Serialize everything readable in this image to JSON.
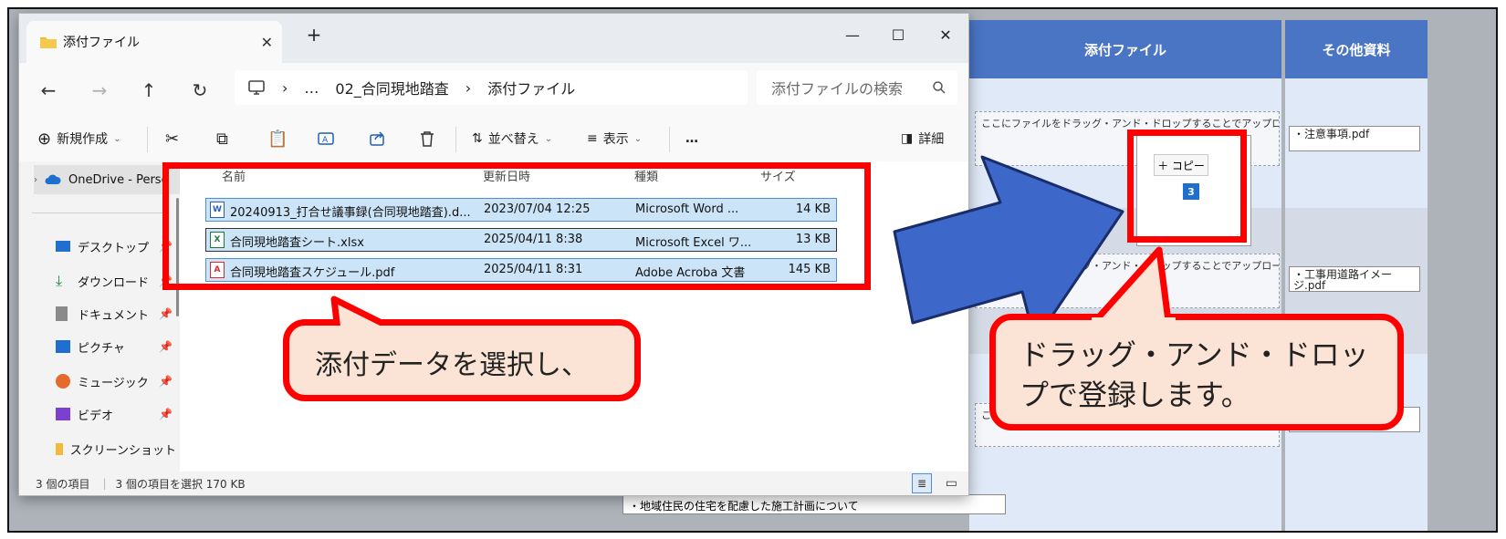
{
  "webapp": {
    "col_attach_header": "添付ファイル",
    "col_other_header": "その他資料",
    "dropzone1_text": "ここにファイルをドラッグ・アンド・ドロップすることでアップロードできます。",
    "dropzone2_text": "ラッグ・アンド・ドロップすることでアップロードできます。",
    "dropzone3_text": "こ",
    "other_file1": "・注意事項.pdf",
    "other_file2": "・工事用道路イメージ.pdf",
    "bottom_note": "・地域住民の住宅を配慮した施工計画について",
    "copy_label": "＋ コピー",
    "copy_count": "3"
  },
  "explorer": {
    "tab_title": "添付ファイル",
    "new_tab": "+",
    "breadcrumb": [
      "02_合同現地踏査",
      "添付ファイル"
    ],
    "breadcrumb_more": "…",
    "search_placeholder": "添付ファイルの検索",
    "toolbar": {
      "new_label": "新規作成",
      "sort_label": "並べ替え",
      "view_label": "表示",
      "more_label": "…",
      "details_label": "詳細"
    },
    "sidebar": {
      "onedrive": "OneDrive - Perso",
      "items": [
        {
          "label": "デスクトップ",
          "icon": "desktop-icon",
          "color": "#1e6fd0"
        },
        {
          "label": "ダウンロード",
          "icon": "download-icon",
          "color": "#1b8a3d"
        },
        {
          "label": "ドキュメント",
          "icon": "document-icon",
          "color": "#6a6a6a"
        },
        {
          "label": "ピクチャ",
          "icon": "picture-icon",
          "color": "#1e6fd0"
        },
        {
          "label": "ミュージック",
          "icon": "music-icon",
          "color": "#e56a2c"
        },
        {
          "label": "ビデオ",
          "icon": "video-icon",
          "color": "#7b3fd1"
        },
        {
          "label": "スクリーンショット",
          "icon": "folder-icon",
          "color": "#f2b93b"
        }
      ]
    },
    "columns": {
      "name": "名前",
      "modified": "更新日時",
      "type": "種類",
      "size": "サイズ"
    },
    "files": [
      {
        "name": "20240913_打合せ議事録(合同現地踏査).d...",
        "modified": "2023/07/04 12:25",
        "type": "Microsoft Word ...",
        "size": "14 KB",
        "icon": "word-icon"
      },
      {
        "name": "合同現地踏査シート.xlsx",
        "modified": "2025/04/11 8:38",
        "type": "Microsoft Excel ワ...",
        "size": "13 KB",
        "icon": "excel-icon"
      },
      {
        "name": "合同現地踏査スケジュール.pdf",
        "modified": "2025/04/11 8:31",
        "type": "Adobe Acroba 文書",
        "size": "145 KB",
        "icon": "pdf-icon"
      }
    ],
    "status_items": "3 個の項目",
    "status_selected": "3 個の項目を選択  170 KB"
  },
  "annotations": {
    "callout_left": "添付データを選択し、",
    "callout_right_line1": "ドラッグ・アンド・ドロッ",
    "callout_right_line2": "プで登録します。",
    "accent_red": "#ff0000",
    "arrow_blue": "#3d68c9"
  }
}
